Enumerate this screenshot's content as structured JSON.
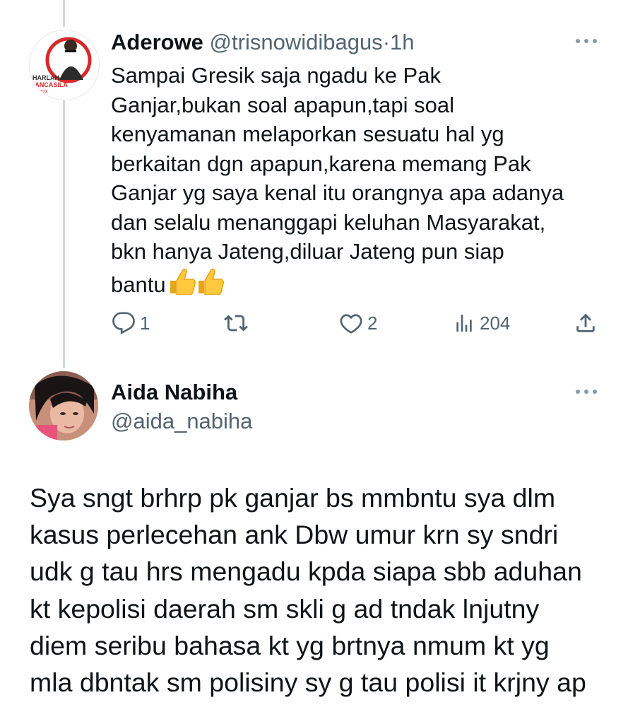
{
  "tweet1": {
    "display_name": "Aderowe",
    "handle": "@trisnowidibagus",
    "separator": "·",
    "time": "1h",
    "text_lines": [
      "Sampai Gresik saja ngadu ke Pak",
      "Ganjar,bukan soal apapun,tapi soal",
      "kenyamanan melaporkan sesuatu hal yg",
      "berkaitan dgn apapun,karena memang Pak",
      "Ganjar yg saya kenal itu orangnya apa adanya",
      "dan selalu menanggapi keluhan Masyarakat,",
      "bkn hanya Jateng,diluar Jateng pun siap",
      "bantu"
    ],
    "emoji": "👍👍",
    "avatar_text": [
      "HARLAH",
      "PANCASILA",
      "2023"
    ],
    "actions": {
      "replies": "1",
      "reposts": "",
      "likes": "2",
      "views": "204"
    }
  },
  "tweet2": {
    "display_name": "Aida Nabiha",
    "handle": "@aida_nabiha",
    "text_lines": [
      "Sya sngt brhrp pk ganjar bs mmbntu sya dlm",
      "kasus perlecehan ank Dbw umur krn sy sndri",
      "udk g tau hrs mengadu kpda siapa sbb aduhan",
      "kt kepolisi daerah sm skli g ad tndak lnjutny",
      "diem seribu bahasa kt yg brtnya nmum kt yg",
      "mla dbntak sm polisiny sy g tau polisi it krjny ap"
    ]
  },
  "icons": {
    "reply": "reply-icon",
    "repost": "repost-icon",
    "like": "heart-icon",
    "views": "views-icon",
    "share": "share-icon",
    "more": "more-icon"
  },
  "colors": {
    "text": "#0f1419",
    "secondary": "#536471",
    "thread_line": "#cfd9de",
    "background": "#ffffff"
  }
}
